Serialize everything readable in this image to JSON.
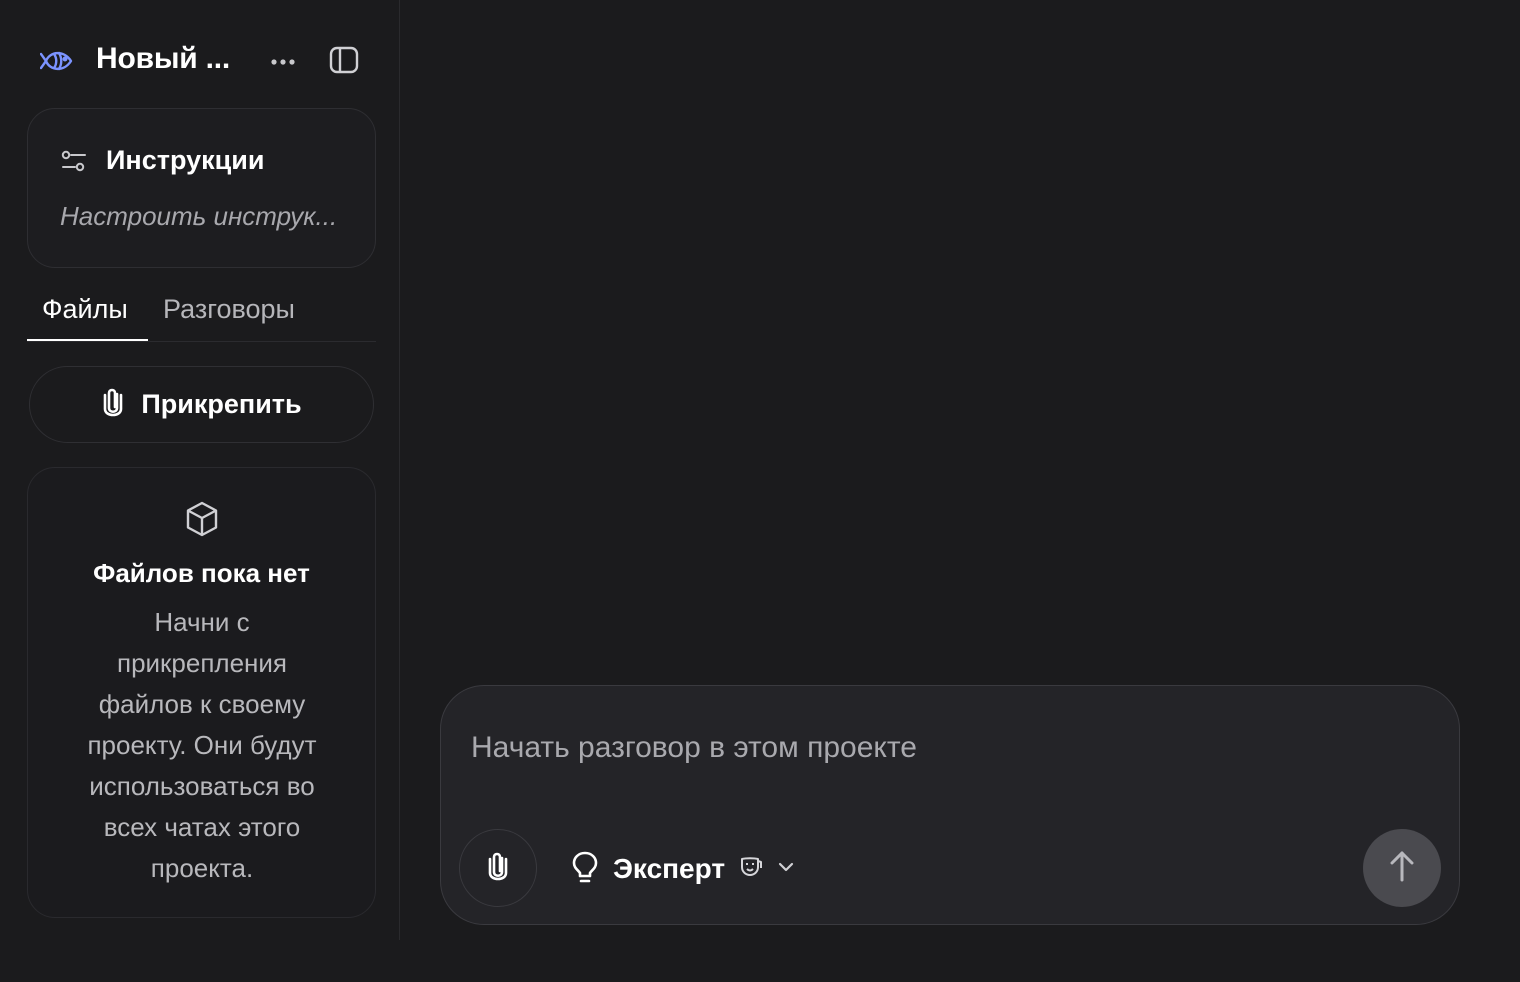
{
  "sidebar": {
    "project_title": "Новый ...",
    "instructions": {
      "title": "Инструкции",
      "subtitle": "Настроить инструк..."
    },
    "tabs": [
      {
        "label": "Файлы",
        "active": true
      },
      {
        "label": "Разговоры",
        "active": false
      }
    ],
    "attach_button": "Прикрепить",
    "empty_state": {
      "title": "Файлов пока нет",
      "text": "Начни с прикрепления файлов к своему проекту. Они будут использоваться во всех чатах этого проекта."
    }
  },
  "composer": {
    "placeholder": "Начать разговор в этом проекте",
    "model_label": "Эксперт"
  },
  "icons": {
    "project": "fish-logo-icon",
    "more": "more-horizontal-icon",
    "collapse": "sidebar-toggle-icon",
    "instructions": "sliders-icon",
    "attach": "paperclip-icon",
    "empty": "cube-icon",
    "model": "lightbulb-icon",
    "mode": "mask-icon",
    "dropdown": "chevron-down-icon",
    "send": "arrow-up-icon"
  },
  "colors": {
    "background": "#1b1b1d",
    "composer_bg": "#242428",
    "accent_icon": "#6f8fff",
    "send_button": "#4a4a4f"
  }
}
